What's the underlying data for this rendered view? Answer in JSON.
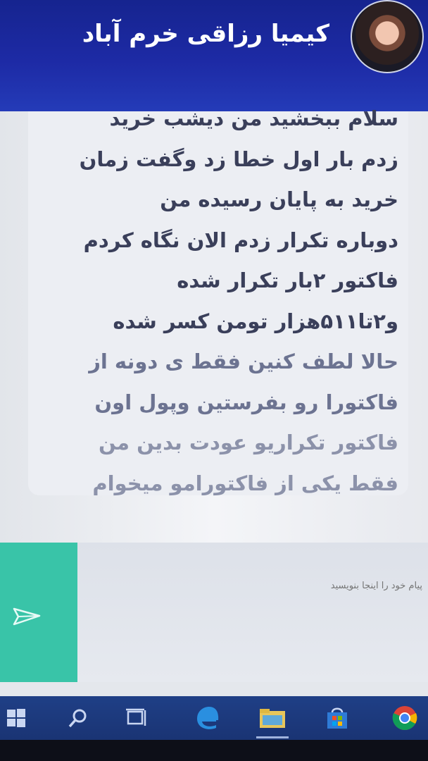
{
  "header": {
    "contact_name": "کیمیا رزاقی خرم آباد"
  },
  "message": {
    "lines": [
      "سلام ببخشید من دیشب خرید",
      "زدم بار اول خطا زد وگفت زمان",
      "خرید به پایان رسیده من",
      "دوباره تکرار زدم الان نگاه کردم",
      "فاکتور ۲بار تکرار شده",
      "و۲تا۵۱۱هزار تومن کسر شده",
      "حالا لطف کنین فقط ی دونه از",
      "فاکتورا رو بفرستین وپول اون",
      "فاکتور تکراریو عودت بدین من",
      "فقط یکی از فاکتورامو میخوام"
    ]
  },
  "compose": {
    "placeholder": "پیام خود را اینجا بنویسید",
    "send_icon": "send-icon"
  },
  "taskbar": {
    "items": [
      "windows-start-icon",
      "search-icon",
      "task-view-icon",
      "edge-icon",
      "file-explorer-icon",
      "store-icon",
      "chrome-icon"
    ]
  },
  "colors": {
    "header": "#1d2aa5",
    "send_button": "#39c4a8",
    "taskbar": "#1f3f86"
  }
}
